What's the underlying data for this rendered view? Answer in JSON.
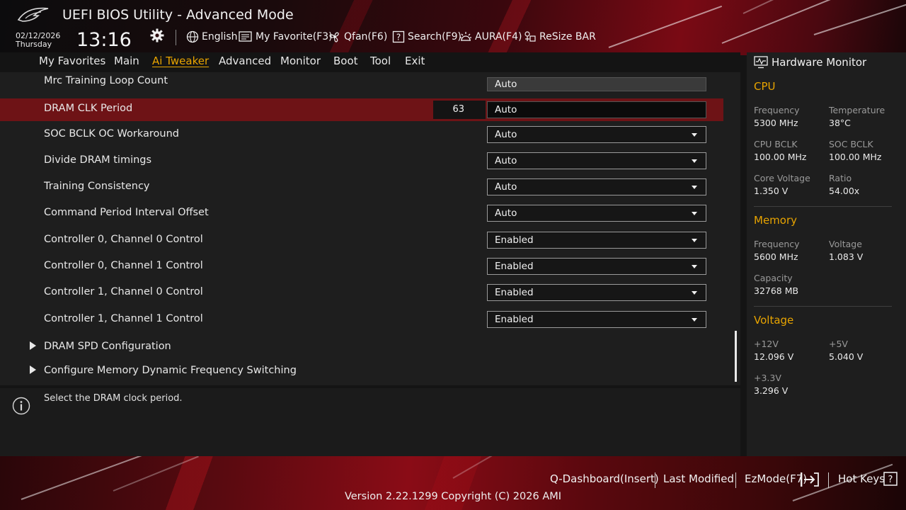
{
  "header": {
    "title": "UEFI BIOS Utility - Advanced Mode",
    "date": "02/12/2026",
    "day": "Thursday",
    "time": "13:16",
    "tools": {
      "language": "English",
      "favorite": "My Favorite(F3)",
      "qfan": "Qfan(F6)",
      "search": "Search(F9)",
      "aura": "AURA(F4)",
      "resize_bar": "ReSize BAR"
    }
  },
  "menu": {
    "favorites": "My Favorites",
    "main": "Main",
    "ai_tweaker": "Ai Tweaker",
    "advanced": "Advanced",
    "monitor": "Monitor",
    "boot": "Boot",
    "tool": "Tool",
    "exit": "Exit",
    "active": "Ai Tweaker"
  },
  "settings": [
    {
      "label": "Mrc Training Loop Count",
      "value": "Auto"
    },
    {
      "label": "DRAM CLK Period",
      "value": "Auto",
      "number": "63",
      "selected": true
    },
    {
      "label": "SOC BCLK OC Workaround",
      "value": "Auto"
    },
    {
      "label": "Divide DRAM timings",
      "value": "Auto"
    },
    {
      "label": "Training Consistency",
      "value": "Auto"
    },
    {
      "label": "Command Period Interval Offset",
      "value": "Auto"
    },
    {
      "label": "Controller 0, Channel 0 Control",
      "value": "Enabled"
    },
    {
      "label": "Controller 0, Channel 1 Control",
      "value": "Enabled"
    },
    {
      "label": "Controller 1, Channel 0 Control",
      "value": "Enabled"
    },
    {
      "label": "Controller 1, Channel 1 Control",
      "value": "Enabled"
    }
  ],
  "submenus": [
    {
      "label": "DRAM SPD Configuration"
    },
    {
      "label": "Configure Memory Dynamic Frequency Switching"
    }
  ],
  "help": {
    "text": "Select the DRAM clock period."
  },
  "hardware_monitor": {
    "title": "Hardware Monitor",
    "cpu": {
      "heading": "CPU",
      "frequency_label": "Frequency",
      "frequency": "5300 MHz",
      "temperature_label": "Temperature",
      "temperature": "38°C",
      "cpu_bclk_label": "CPU BCLK",
      "cpu_bclk": "100.00 MHz",
      "soc_bclk_label": "SOC BCLK",
      "soc_bclk": "100.00 MHz",
      "core_voltage_label": "Core Voltage",
      "core_voltage": "1.350 V",
      "ratio_label": "Ratio",
      "ratio": "54.00x"
    },
    "memory": {
      "heading": "Memory",
      "frequency_label": "Frequency",
      "frequency": "5600 MHz",
      "voltage_label": "Voltage",
      "voltage": "1.083 V",
      "capacity_label": "Capacity",
      "capacity": "32768 MB"
    },
    "voltage": {
      "heading": "Voltage",
      "v12_label": "+12V",
      "v12": "12.096 V",
      "v5_label": "+5V",
      "v5": "5.040 V",
      "v33_label": "+3.3V",
      "v33": "3.296 V"
    }
  },
  "footer": {
    "qdashboard": "Q-Dashboard(Insert)",
    "last_modified": "Last Modified",
    "ezmode": "EzMode(F7)",
    "hotkeys": "Hot Keys",
    "hotkeys_key": "?",
    "version": "Version 2.22.1299 Copyright (C) 2026 AMI"
  },
  "colors": {
    "accent": "#e8a400",
    "selected_row": "#6e1316",
    "brand_red": "#8a0c16"
  }
}
